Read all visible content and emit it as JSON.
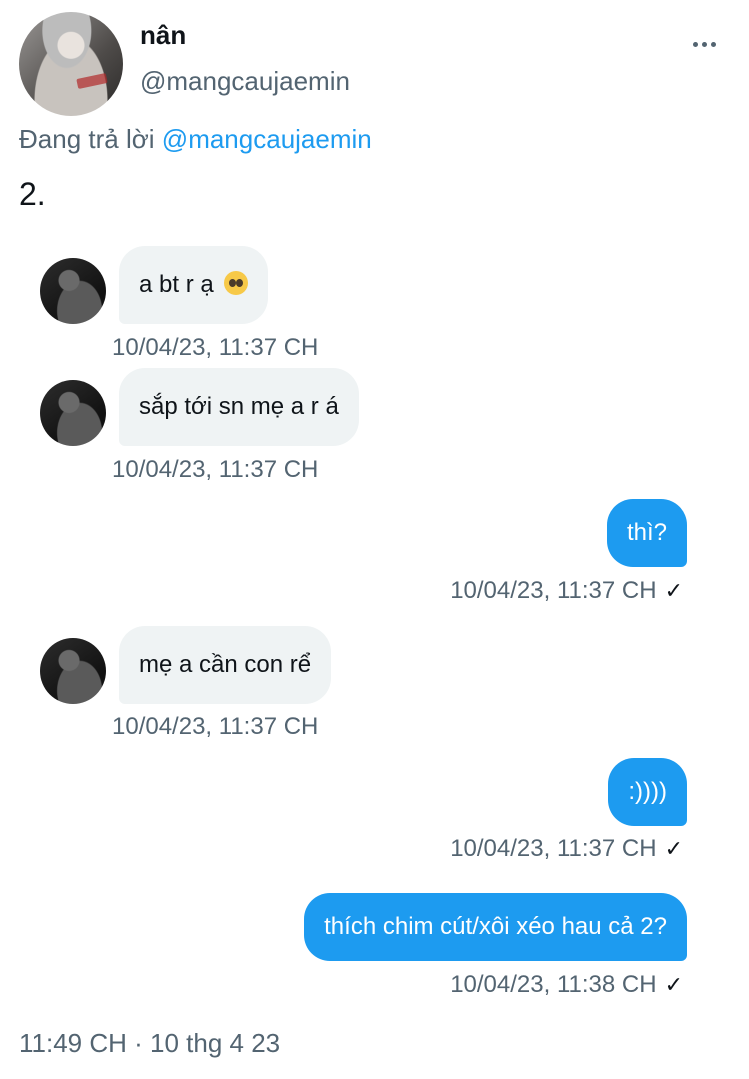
{
  "header": {
    "display_name": "nân",
    "handle": "@mangcaujaemin",
    "more_icon": "more-horizontal-icon"
  },
  "reply": {
    "prefix": "Đang trả lời",
    "mention": "@mangcaujaemin"
  },
  "tweet_text": "2.",
  "messages": [
    {
      "direction": "in",
      "text": "a bt r ạ",
      "emoji": "pleading-face-emoji",
      "time": "10/04/23, 11:37 CH"
    },
    {
      "direction": "in",
      "text": "sắp tới sn mẹ a r á",
      "time": "10/04/23, 11:37 CH"
    },
    {
      "direction": "out",
      "text": "thì?",
      "time": "10/04/23, 11:37 CH",
      "seen": "✓"
    },
    {
      "direction": "in",
      "text": "mẹ a cần con rể",
      "time": "10/04/23, 11:37 CH"
    },
    {
      "direction": "out",
      "text": ":))))",
      "time": "10/04/23, 11:37 CH",
      "seen": "✓"
    },
    {
      "direction": "out",
      "text": "thích chim cút/xôi xéo hau cả 2?",
      "time": "10/04/23, 11:38 CH",
      "seen": "✓"
    }
  ],
  "footer": {
    "timestamp": "11:49 CH · 10 thg 4 23"
  },
  "colors": {
    "accent": "#1d9bf0",
    "incoming_bubble": "#eff3f4",
    "muted_text": "#536471"
  }
}
